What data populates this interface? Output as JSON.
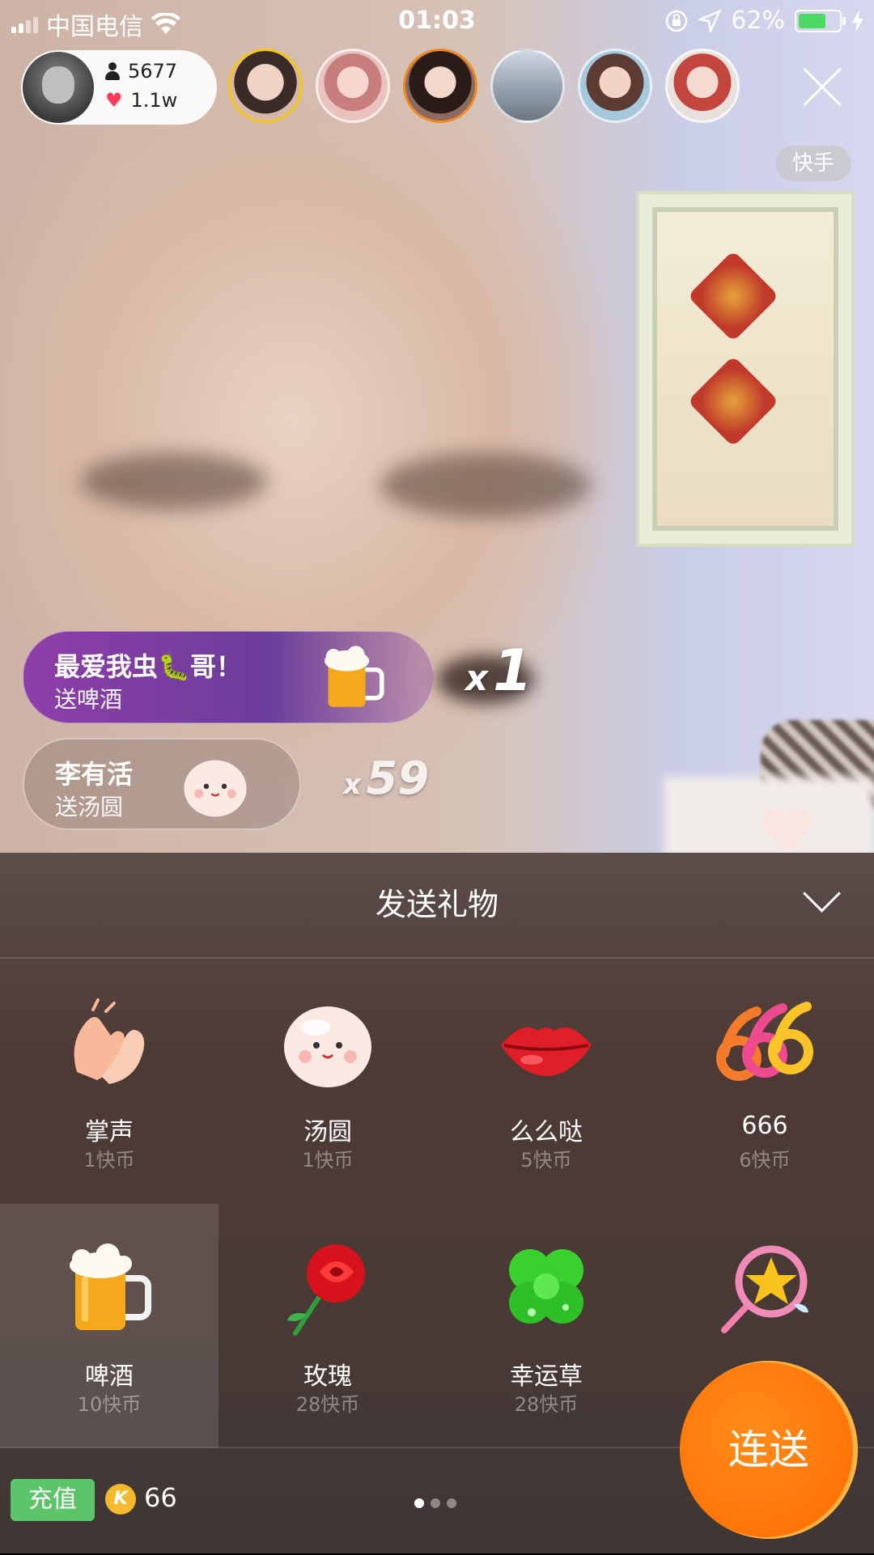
{
  "status_bar": {
    "carrier": "中国电信",
    "time": "01:03",
    "battery": "62%"
  },
  "host": {
    "viewers": "5677",
    "likes": "1.1w"
  },
  "brand_badge": "快手",
  "notifications": [
    {
      "name": "最爱我虫🐛哥！",
      "action": "送啤酒",
      "combo_prefix": "x",
      "combo_count": "1"
    },
    {
      "name": "李有活",
      "action": "送汤圆",
      "combo_prefix": "x",
      "combo_count": "59"
    }
  ],
  "gift_panel": {
    "title": "发送礼物",
    "gifts": [
      {
        "name": "掌声",
        "price": "1快币",
        "icon": "clapping-hands-icon"
      },
      {
        "name": "汤圆",
        "price": "1快币",
        "icon": "tangyuan-icon"
      },
      {
        "name": "么么哒",
        "price": "5快币",
        "icon": "lips-icon"
      },
      {
        "name": "666",
        "price": "6快币",
        "icon": "666-icon"
      },
      {
        "name": "啤酒",
        "price": "10快币",
        "icon": "beer-icon",
        "selected": true
      },
      {
        "name": "玫瑰",
        "price": "28快币",
        "icon": "rose-icon"
      },
      {
        "name": "幸运草",
        "price": "28快币",
        "icon": "clover-icon"
      },
      {
        "name": "",
        "price": "",
        "icon": "magic-wand-icon"
      }
    ],
    "recharge_label": "充值",
    "coin_symbol": "K",
    "coin_balance": "66",
    "combo_send_label": "连送"
  },
  "colors": {
    "accent_orange": "#ff7a00",
    "recharge_green": "#5cc56a",
    "coin_gold": "#f5b92e",
    "like_red": "#ff3b5c"
  }
}
